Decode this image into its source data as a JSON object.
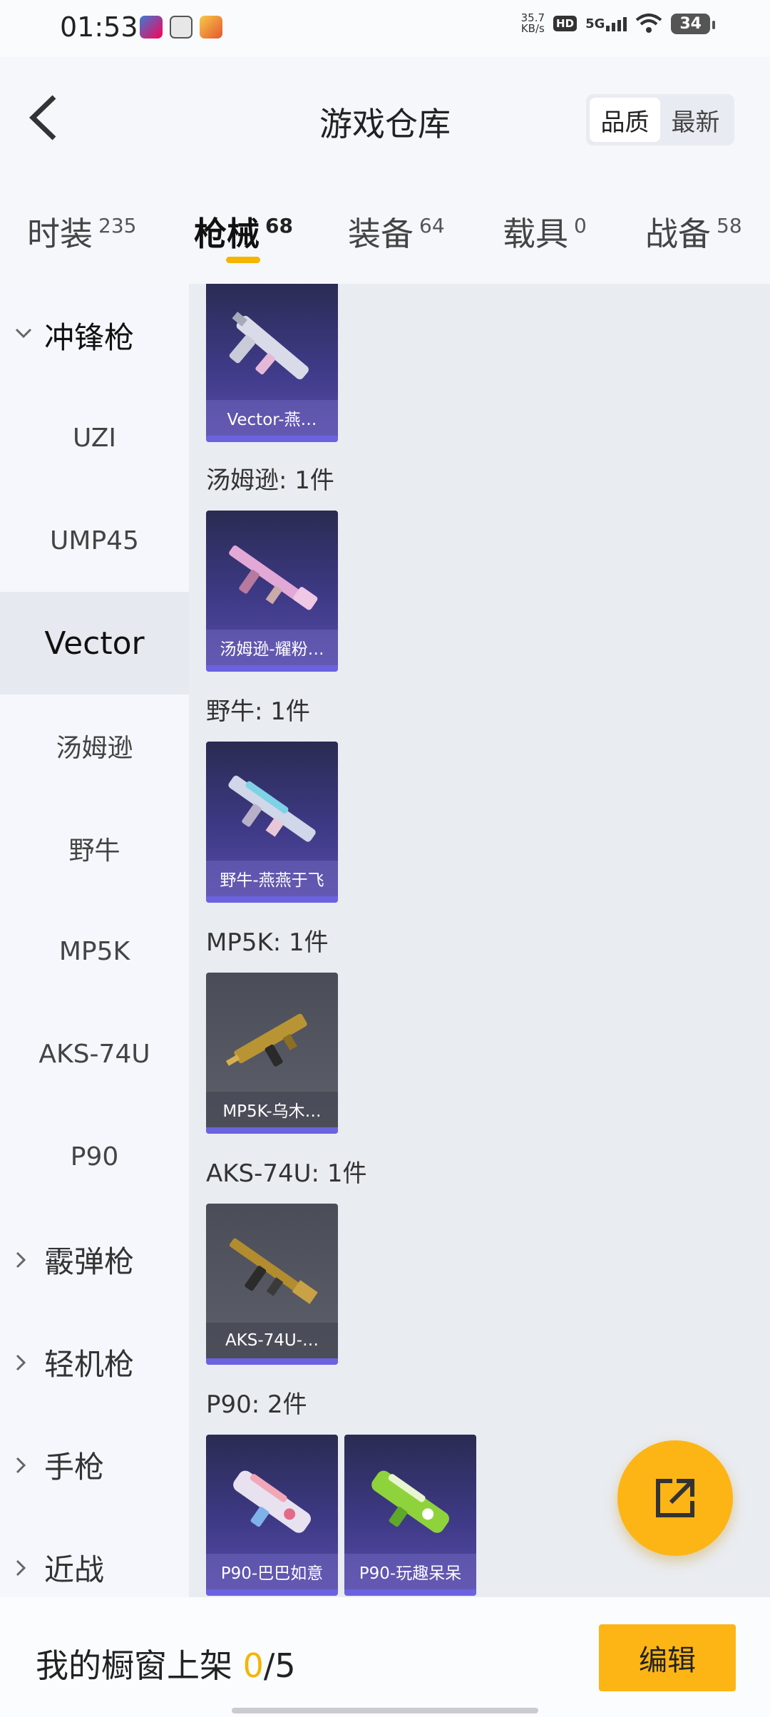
{
  "status": {
    "time": "01:53",
    "speed_value": "35.7",
    "speed_unit": "KB/s",
    "hd": "HD",
    "network": "5G",
    "battery": "34"
  },
  "header": {
    "title": "游戏仓库",
    "sort_options": [
      "品质",
      "最新"
    ],
    "sort_selected": "品质"
  },
  "tabs": [
    {
      "label": "时装",
      "count": "235"
    },
    {
      "label": "枪械",
      "count": "68",
      "active": true
    },
    {
      "label": "装备",
      "count": "64"
    },
    {
      "label": "载具",
      "count": "0"
    },
    {
      "label": "战备",
      "count": "58"
    }
  ],
  "sidebar": {
    "groups": [
      "冲锋枪",
      "霰弹枪",
      "轻机枪",
      "手枪",
      "近战"
    ],
    "items": [
      "UZI",
      "UMP45",
      "Vector",
      "汤姆逊",
      "野牛",
      "MP5K",
      "AKS-74U",
      "P90"
    ],
    "selected": "Vector"
  },
  "content": {
    "sections": [
      {
        "label": "",
        "cards": [
          "Vector-燕…"
        ]
      },
      {
        "label": "汤姆逊: 1件",
        "cards": [
          "汤姆逊-耀粉…"
        ]
      },
      {
        "label": "野牛: 1件",
        "cards": [
          "野牛-燕燕于飞"
        ]
      },
      {
        "label": "MP5K: 1件",
        "cards": [
          "MP5K-乌木…"
        ]
      },
      {
        "label": "AKS-74U: 1件",
        "cards": [
          "AKS-74U-…"
        ]
      },
      {
        "label": "P90: 2件",
        "cards": [
          "P90-巴巴如意",
          "P90-玩趣呆呆"
        ]
      }
    ]
  },
  "bottom": {
    "shelf_label": "我的橱窗上架",
    "shelf_current": "0",
    "shelf_total": "/5",
    "edit_label": "编辑"
  },
  "colors": {
    "accent": "#fdb515",
    "card_purple": "#3f3a88",
    "card_gray": "#5e616b",
    "card_strip": "#6b62e0"
  }
}
